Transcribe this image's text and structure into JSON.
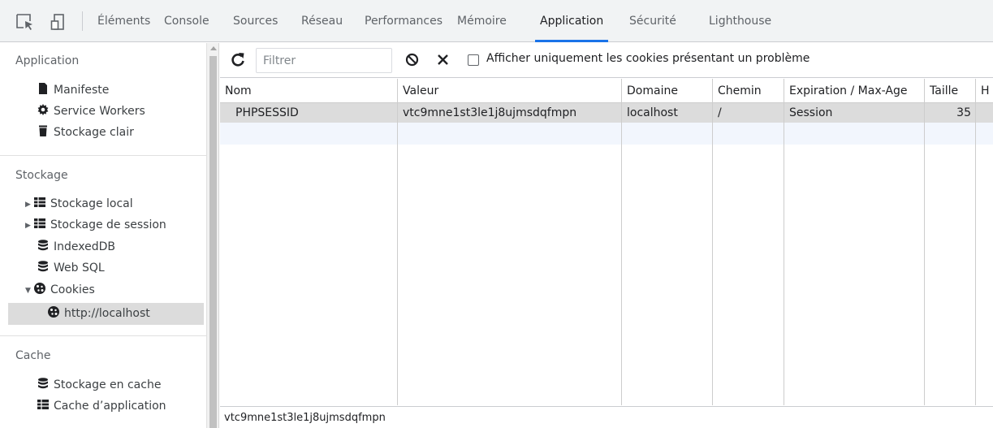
{
  "devtools_tabs": [
    {
      "label": "Éléments",
      "active": false
    },
    {
      "label": "Console",
      "active": false
    },
    {
      "label": "Sources",
      "active": false
    },
    {
      "label": "Réseau",
      "active": false
    },
    {
      "label": "Performances",
      "active": false
    },
    {
      "label": "Mémoire",
      "active": false
    },
    {
      "label": "Application",
      "active": true
    },
    {
      "label": "Sécurité",
      "active": false
    },
    {
      "label": "Lighthouse",
      "active": false
    }
  ],
  "colors": {
    "accent": "#1a73e8",
    "selected_row": "#dcdcdc"
  },
  "sidebar": {
    "application": {
      "title": "Application",
      "items": [
        {
          "label": "Manifeste",
          "icon": "document-icon"
        },
        {
          "label": "Service Workers",
          "icon": "gear-icon"
        },
        {
          "label": "Stockage clair",
          "icon": "trash-icon"
        }
      ]
    },
    "storage": {
      "title": "Stockage",
      "items": [
        {
          "label": "Stockage local",
          "icon": "table-icon",
          "expandable": true,
          "expanded": false
        },
        {
          "label": "Stockage de session",
          "icon": "table-icon",
          "expandable": true,
          "expanded": false
        },
        {
          "label": "IndexedDB",
          "icon": "database-icon"
        },
        {
          "label": "Web SQL",
          "icon": "database-icon"
        },
        {
          "label": "Cookies",
          "icon": "cookie-icon",
          "expandable": true,
          "expanded": true
        },
        {
          "label": "http://localhost",
          "icon": "cookie-icon",
          "selected": true
        }
      ]
    },
    "cache": {
      "title": "Cache",
      "items": [
        {
          "label": "Stockage en cache",
          "icon": "database-icon"
        },
        {
          "label": "Cache d’application",
          "icon": "table-icon"
        }
      ]
    }
  },
  "toolbar": {
    "filter_placeholder": "Filtrer",
    "filter_value": "",
    "only_issues_label": "Afficher uniquement les cookies présentant un problème",
    "only_issues_checked": false
  },
  "table": {
    "columns": [
      "Nom",
      "Valeur",
      "Domaine",
      "Chemin",
      "Expiration / Max-Age",
      "Taille",
      "H"
    ],
    "rows": [
      {
        "name": "PHPSESSID",
        "value": "vtc9mne1st3le1j8ujmsdqfmpn",
        "domain": "localhost",
        "path": "/",
        "expires": "Session",
        "size": "35",
        "http": ""
      }
    ]
  },
  "preview": {
    "value": "vtc9mne1st3le1j8ujmsdqfmpn"
  }
}
